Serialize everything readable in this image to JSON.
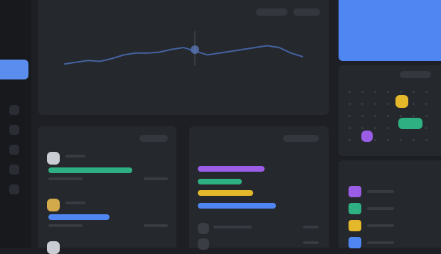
{
  "sidebar": {
    "items": [
      "nav-home",
      "nav-analytics",
      "nav-projects",
      "nav-calendar",
      "nav-tasks",
      "nav-settings"
    ]
  },
  "overview": {
    "title": "",
    "controls": [
      "",
      ""
    ],
    "chart": [
      12,
      14,
      16,
      15,
      18,
      22,
      24,
      24,
      25,
      28,
      30,
      26,
      22,
      24,
      26,
      28,
      30,
      32,
      30,
      24,
      20
    ]
  },
  "left_list": {
    "title": "",
    "action": ""
  },
  "middle_list": {
    "title": "",
    "action": ""
  },
  "calendar": {
    "title": "",
    "action": ""
  },
  "legend": {
    "title": ""
  },
  "colors": {
    "accent": "#5b8def",
    "green": "#2fb082",
    "purple": "#9b5de5",
    "yellow": "#e5b72a",
    "blue": "#4f86f2",
    "background": "#1d1f24",
    "panel": "#25282d"
  }
}
